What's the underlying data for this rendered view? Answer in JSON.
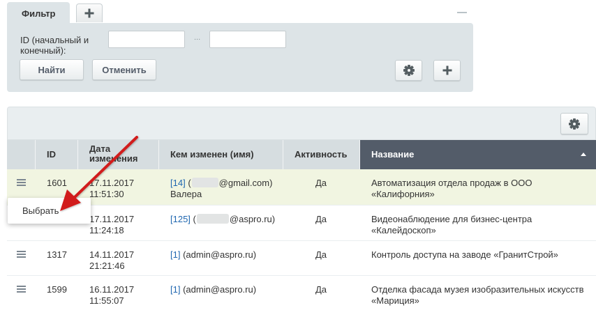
{
  "filter": {
    "tab_label": "Фильтр",
    "id_label": "ID (начальный и конечный):",
    "range_separator": "...",
    "id_from_value": "",
    "id_to_value": "",
    "find_button": "Найти",
    "cancel_button": "Отменить"
  },
  "grid": {
    "columns": [
      "ID",
      "Дата изменения",
      "Кем изменен (имя)",
      "Активность",
      "Название"
    ],
    "sorted_column": "Название",
    "sort_direction": "ascending",
    "rows": [
      {
        "id": "1601",
        "date": "17.11.2017",
        "time": "11:51:30",
        "user_id": "[14]",
        "user_email_open": "(",
        "user_email_domain": "@gmail.com)",
        "user_name": "Валера",
        "active": "Да",
        "name": "Автоматизация отдела продаж в ООО «Калифорния»"
      },
      {
        "id": "",
        "date": "17.11.2017",
        "time": "11:24:18",
        "user_id": "[125]",
        "user_email_open": "(",
        "user_email_domain": "@aspro.ru)",
        "user_name": "",
        "active": "Да",
        "name": "Видеонаблюдение для бизнес-центра «Калейдоскоп»"
      },
      {
        "id": "1317",
        "date": "14.11.2017",
        "time": "21:21:46",
        "user_id": "[1]",
        "user_email": "(admin@aspro.ru)",
        "active": "Да",
        "name": "Контроль доступа на заводе «ГранитСтрой»"
      },
      {
        "id": "1599",
        "date": "16.11.2017",
        "time": "11:55:07",
        "user_id": "[1]",
        "user_email": "(admin@aspro.ru)",
        "active": "Да",
        "name": "Отделка фасада музея изобразительных искусств «Мариция»"
      }
    ]
  },
  "context_menu": {
    "select_item": "Выбрать"
  },
  "colors": {
    "panel_bg": "#dde4e7",
    "header_bg": "#d6dde0",
    "sorted_header_bg": "#535c69",
    "hover_row_bg": "#f1f5e1",
    "link": "#2067b0",
    "annotation_arrow": "#d11f1f"
  },
  "icons": [
    "plus-icon",
    "collapse-icon",
    "gear-icon",
    "row-menu-icon",
    "sort-ascending-icon",
    "annotation-arrow"
  ]
}
